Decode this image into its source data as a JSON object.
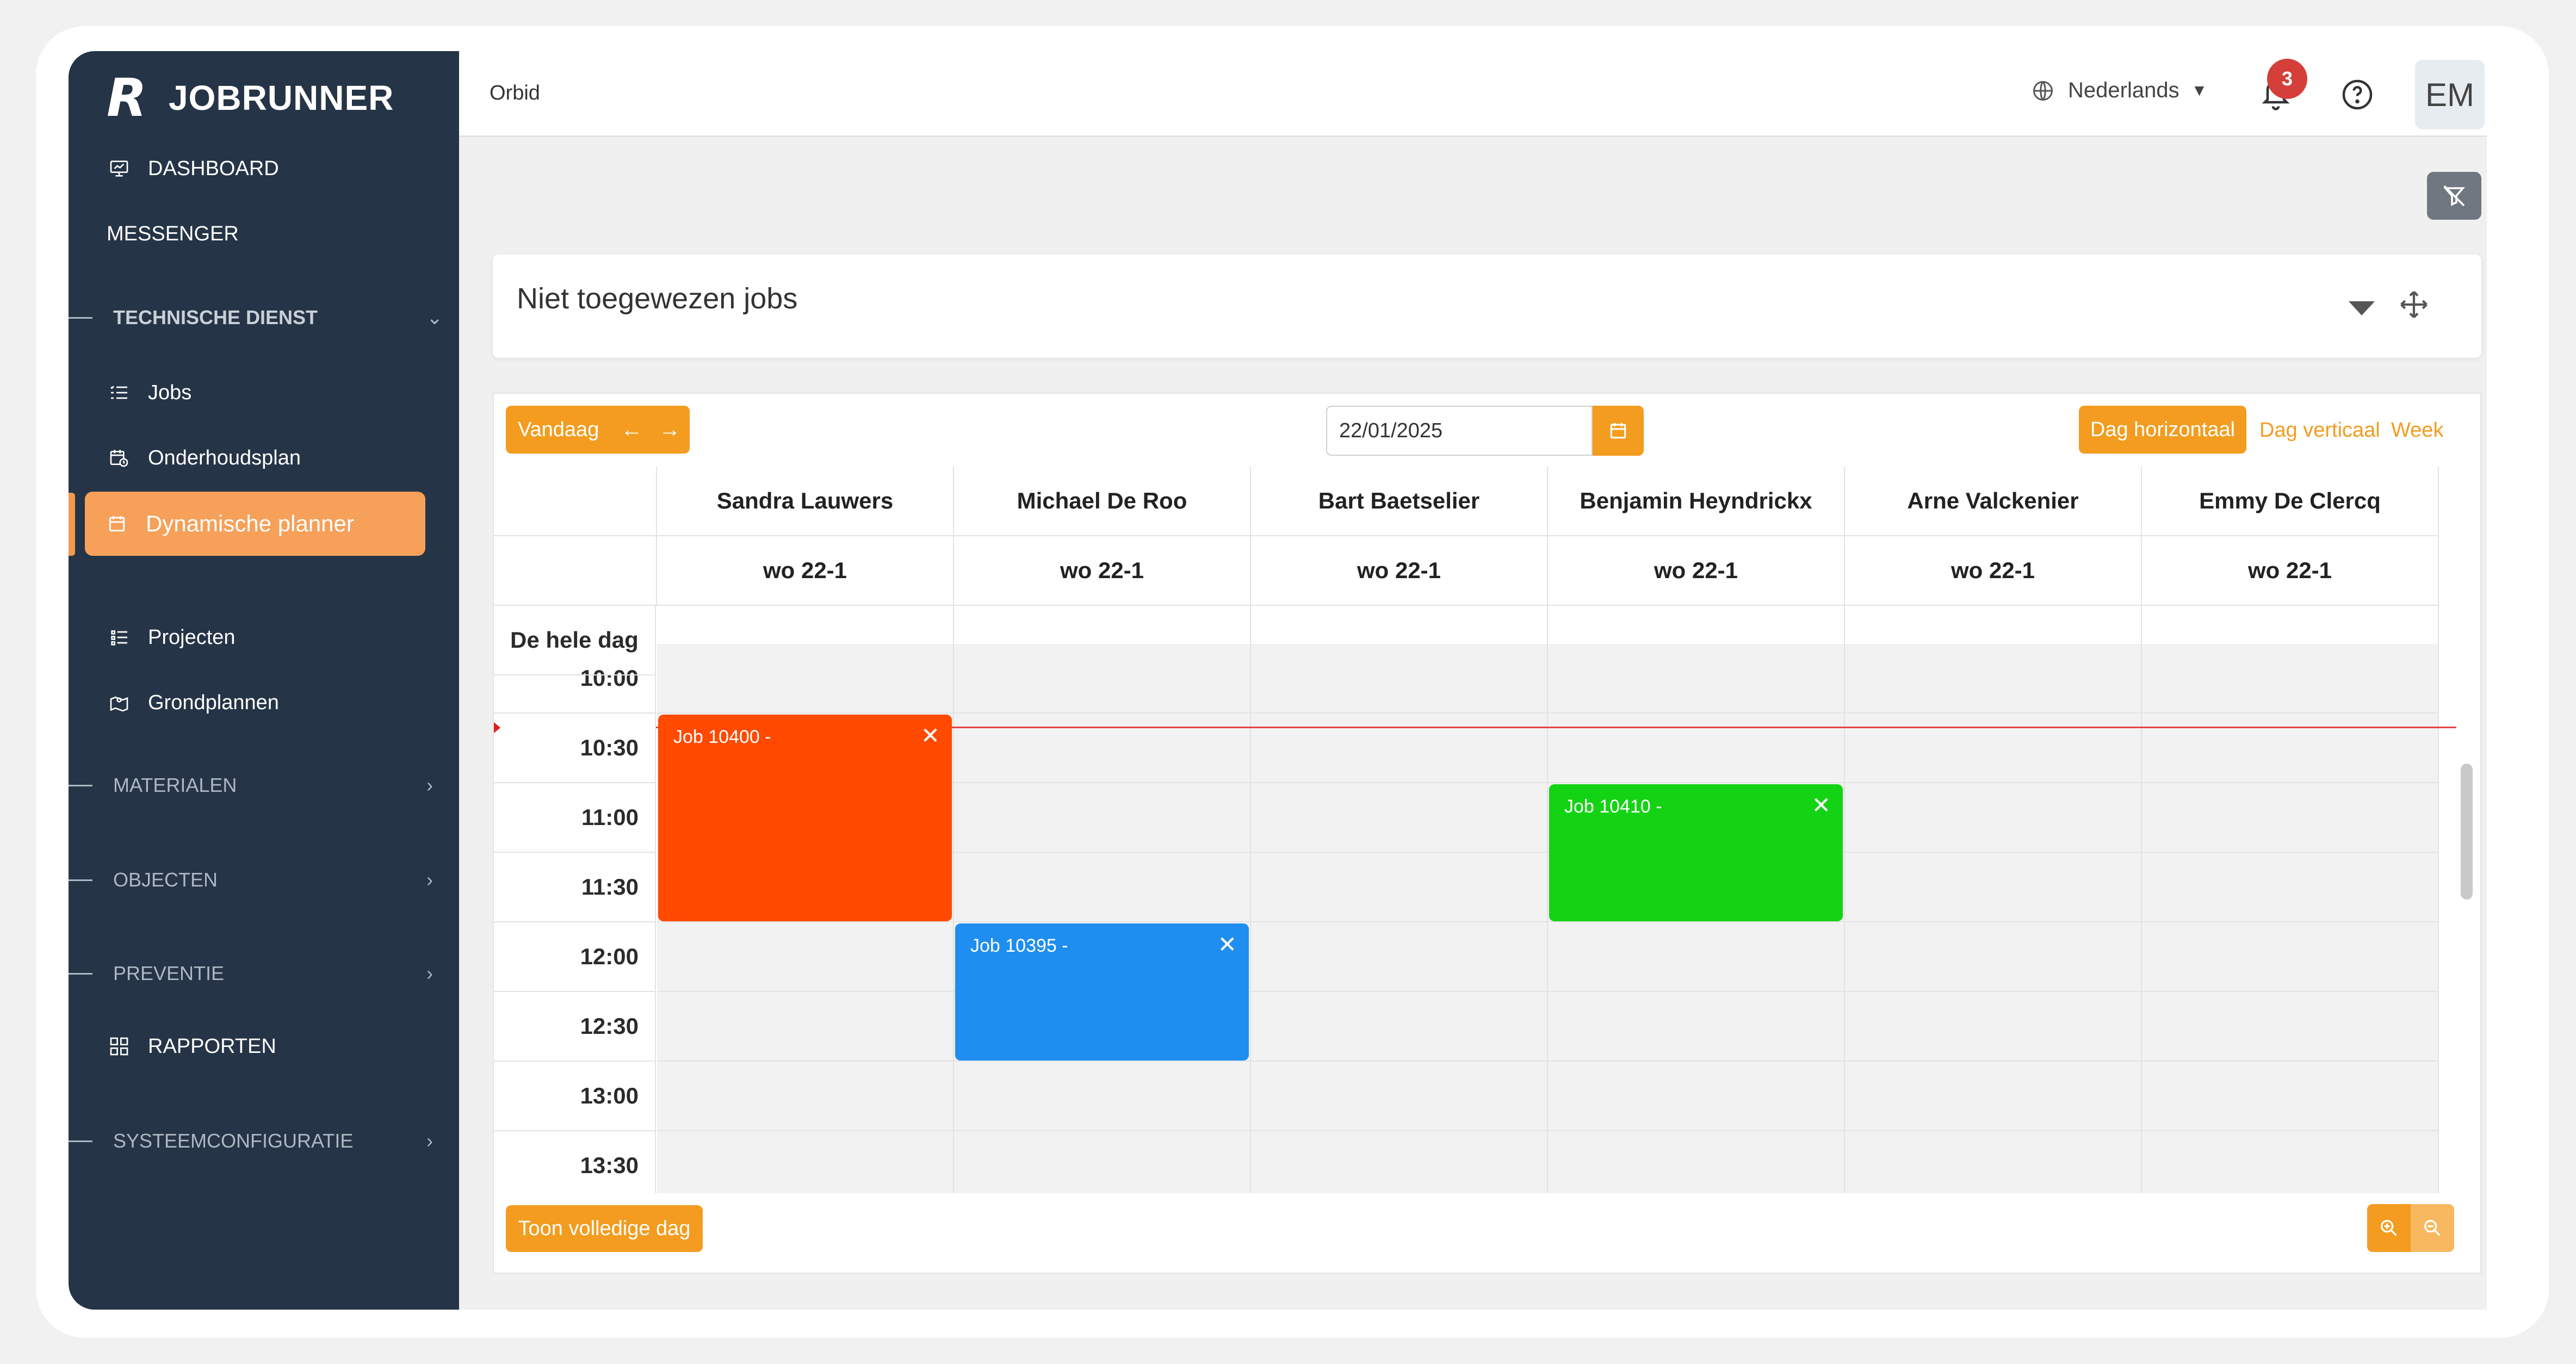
{
  "app": {
    "name": "JOBRUNNER",
    "logo_letter": "R"
  },
  "sidebar": {
    "dashboard": "DASHBOARD",
    "messenger": "MESSENGER",
    "sections": {
      "technical": "TECHNISCHE DIENST",
      "materials": "MATERIALEN",
      "objects": "OBJECTEN",
      "prevention": "PREVENTIE",
      "system": "SYSTEEMCONFIGURATIE"
    },
    "items": {
      "jobs": "Jobs",
      "maintenance": "Onderhoudsplan",
      "planner": "Dynamische planner",
      "projects": "Projecten",
      "floorplans": "Grondplannen",
      "reports": "RAPPORTEN"
    }
  },
  "topbar": {
    "breadcrumb": "Orbid",
    "language": "Nederlands",
    "notifications": "3",
    "avatar": "EM"
  },
  "unassigned": {
    "title": "Niet toegewezen jobs"
  },
  "planner": {
    "today": "Vandaag",
    "date": "22/01/2025",
    "views": {
      "day_horizontal": "Dag horizontaal",
      "day_vertical": "Dag verticaal",
      "week": "Week"
    },
    "all_day": "De hele dag",
    "full_day_button": "Toon volledige dag",
    "resources": [
      "Sandra Lauwers",
      "Michael De Roo",
      "Bart Baetselier",
      "Benjamin Heyndrickx",
      "Arne Valckenier",
      "Emmy De Clercq"
    ],
    "day_label": "wo 22-1",
    "times": [
      "10:00",
      "10:30",
      "11:00",
      "11:30",
      "12:00",
      "12:30",
      "13:00",
      "13:30"
    ],
    "jobs": [
      {
        "label": "Job 10400 -",
        "resource": "Sandra Lauwers",
        "start": "10:30",
        "end": "12:00",
        "color": "#ff4a00"
      },
      {
        "label": "Job 10395 -",
        "resource": "Michael De Roo",
        "start": "12:00",
        "end": "13:00",
        "color": "#1f8ef1"
      },
      {
        "label": "Job 10410 -",
        "resource": "Benjamin Heyndrickx",
        "start": "11:00",
        "end": "12:00",
        "color": "#14d314"
      }
    ],
    "close_glyph": "✕"
  },
  "colors": {
    "sidebar": "#253446",
    "accent": "#f39c1f",
    "active": "#f6a05a"
  }
}
